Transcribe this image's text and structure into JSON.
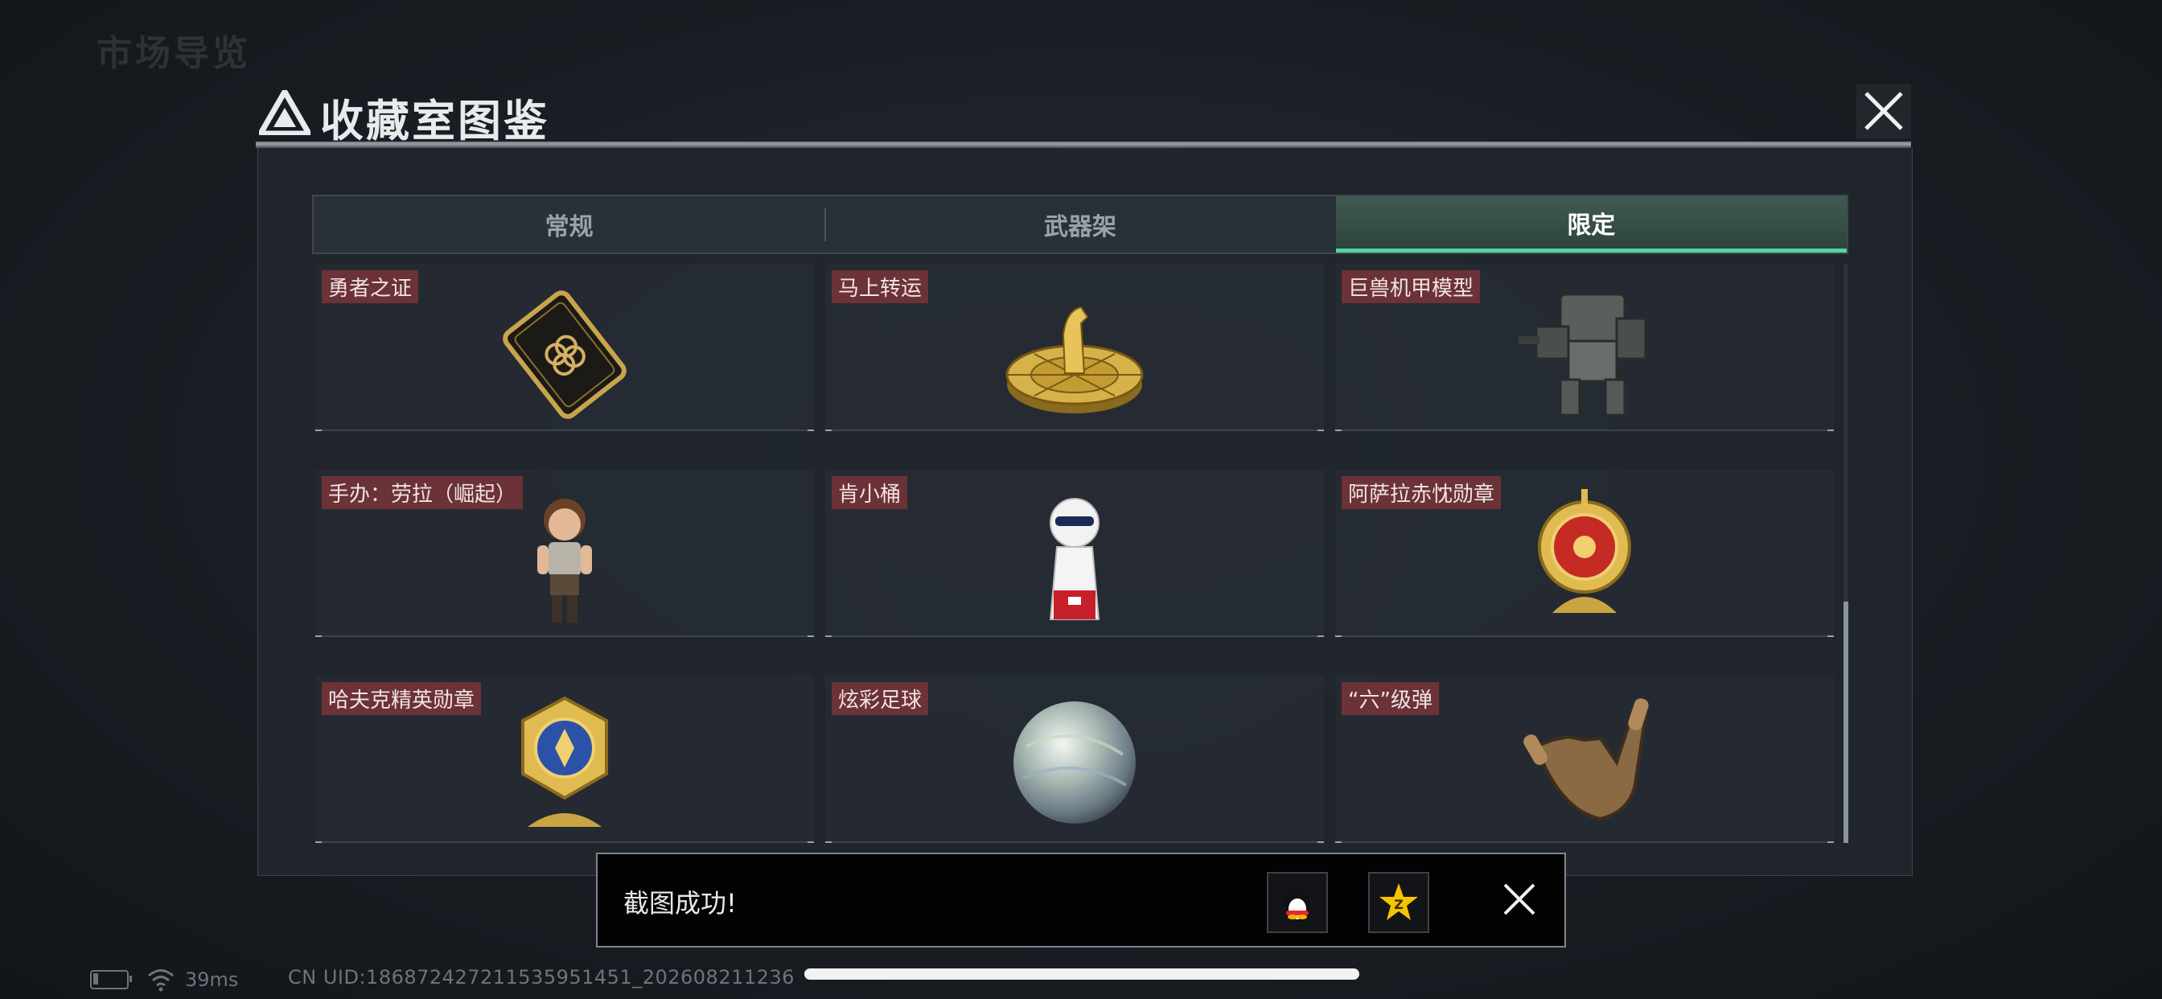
{
  "background": {
    "back_label": "市场导览"
  },
  "dialog": {
    "title": "收藏室图鉴"
  },
  "tabs": [
    {
      "label": "常规",
      "active": false
    },
    {
      "label": "武器架",
      "active": false
    },
    {
      "label": "限定",
      "active": true
    }
  ],
  "items": [
    {
      "name": "勇者之证",
      "icon": "card-icon"
    },
    {
      "name": "马上转运",
      "icon": "horse-wheel-icon"
    },
    {
      "name": "巨兽机甲模型",
      "icon": "mech-model-icon"
    },
    {
      "name": "手办：劳拉（崛起）",
      "icon": "figure-icon"
    },
    {
      "name": "肯小桶",
      "icon": "kfc-figure-icon"
    },
    {
      "name": "阿萨拉赤忱勋章",
      "icon": "medal-red-icon"
    },
    {
      "name": "哈夫克精英勋章",
      "icon": "medal-blue-icon"
    },
    {
      "name": "炫彩足球",
      "icon": "football-icon"
    },
    {
      "name": "“六”级弹",
      "icon": "hand-bullet-icon"
    }
  ],
  "toast": {
    "message": "截图成功!",
    "share": [
      "qq-icon",
      "qzone-icon"
    ]
  },
  "status": {
    "ping": "39ms",
    "uid": "CN UID:1868724272115359514​51_202608211236"
  },
  "colors": {
    "accent": "#4fd6a6",
    "label_bg": "#783438"
  }
}
